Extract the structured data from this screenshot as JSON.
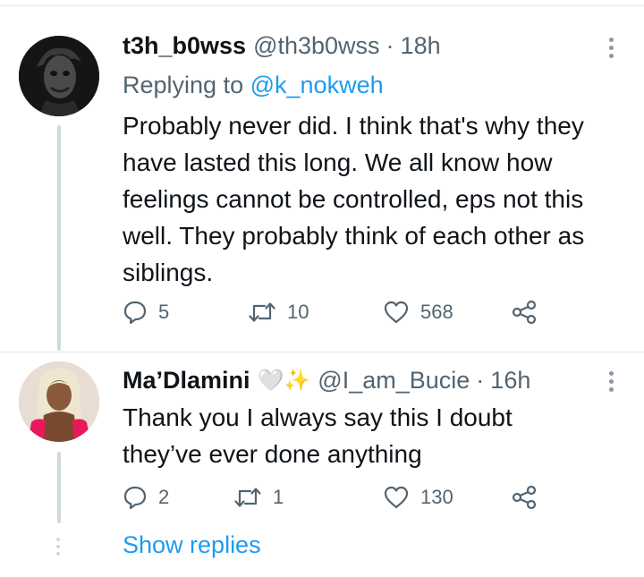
{
  "tweets": [
    {
      "display_name": "t3h_b0wss",
      "handle": "@th3b0wss",
      "separator": "·",
      "time": "18h",
      "replying_prefix": "Replying to",
      "replying_to": "@k_nokweh",
      "text_lines": [
        "Probably never did. I think that's why they",
        "have lasted this long. We all know how",
        "feelings cannot be controlled, eps not this",
        "well. They probably think of each other as",
        "siblings."
      ],
      "replies": "5",
      "retweets": "10",
      "likes": "568",
      "avatar_icon": "joker-avatar"
    },
    {
      "display_name": "Ma’Dlamini",
      "name_emoji": "🤍✨",
      "handle": "@I_am_Bucie",
      "separator": "·",
      "time": "16h",
      "text_lines": [
        "Thank you I always say this I doubt",
        "they’ve ever done anything"
      ],
      "replies": "2",
      "retweets": "1",
      "likes": "130",
      "avatar_icon": "woman-avatar"
    }
  ],
  "show_replies": "Show replies",
  "icons": {
    "reply": "reply-icon",
    "retweet": "retweet-icon",
    "like": "heart-icon",
    "share": "share-icon",
    "more": "more-vertical-icon"
  },
  "colors": {
    "text": "#0f1419",
    "muted": "#536471",
    "link": "#1d9bf0",
    "thread_line": "#cfd9de",
    "sparkle": "#f5b400"
  }
}
